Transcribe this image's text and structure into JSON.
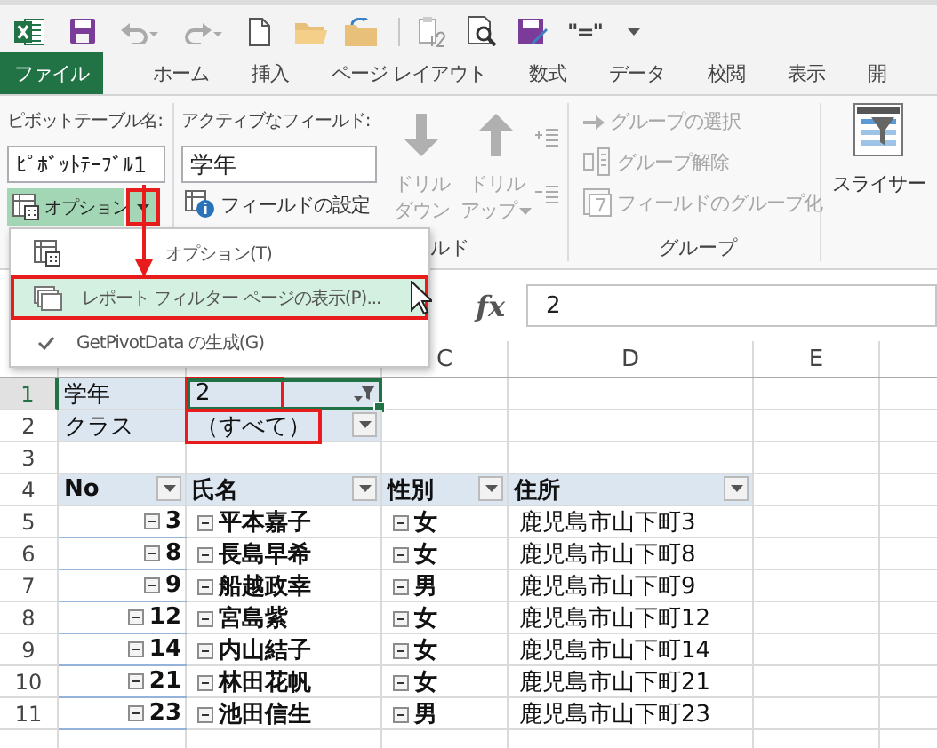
{
  "quick_access": {
    "equals_label": "\"=\""
  },
  "tabs": [
    {
      "label": "ファイル",
      "kind": "file",
      "selected": false
    },
    {
      "label": "ホーム",
      "kind": "tab",
      "selected": false
    },
    {
      "label": "挿入",
      "kind": "tab",
      "selected": false
    },
    {
      "label": "ページ レイアウト",
      "kind": "tab",
      "selected": false
    },
    {
      "label": "数式",
      "kind": "tab",
      "selected": false
    },
    {
      "label": "データ",
      "kind": "tab",
      "selected": false
    },
    {
      "label": "校閲",
      "kind": "tab",
      "selected": false
    },
    {
      "label": "表示",
      "kind": "tab",
      "selected": false
    },
    {
      "label": "開",
      "kind": "tab",
      "selected": false
    }
  ],
  "ribbon": {
    "pivot_name": {
      "label": "ピボットテーブル名:",
      "value": "ﾋﾟﾎﾞｯﾄﾃｰﾌﾞﾙ1"
    },
    "options_button": {
      "label": "オプション",
      "pressed": true,
      "dropdown_annotated": true
    },
    "active_field": {
      "label": "アクティブなフィールド:",
      "value": "学年",
      "settings_label": "フィールドの設定",
      "drill_down": {
        "label_lines": [
          "ドリル",
          "ダウン"
        ],
        "disabled": true
      },
      "drill_up": {
        "label_lines": [
          "ドリル",
          "アップ"
        ],
        "disabled": true
      },
      "group_label": "ルド"
    },
    "group": {
      "items": [
        {
          "label": "グループの選択",
          "kind": "select",
          "disabled": true
        },
        {
          "label": "グループ解除",
          "kind": "ungroup",
          "disabled": true
        },
        {
          "label": "フィールドのグループ化",
          "kind": "group-field",
          "disabled": true
        }
      ],
      "group_label": "グループ"
    },
    "slicer": {
      "label": "スライサー"
    }
  },
  "menu": {
    "items": [
      {
        "label": "オプション(T)",
        "kind": "options",
        "selected": false,
        "annotated": false
      },
      {
        "label": "レポート フィルター ページの表示(P)...",
        "kind": "pages",
        "selected": true,
        "annotated": true
      },
      {
        "label": "GetPivotData の生成(G)",
        "kind": "toggle",
        "checked": true,
        "selected": false,
        "annotated": false
      }
    ]
  },
  "formula_bar": {
    "function_label": "fx",
    "value": "2"
  },
  "sheet": {
    "column_headers": [
      "C",
      "D",
      "E"
    ],
    "rows": [
      {
        "number": "1",
        "active": true,
        "cells": [
          {
            "text": "学年",
            "kind": "filter-label"
          },
          {
            "text": "2",
            "kind": "filter-value",
            "filtered": true,
            "active": true,
            "annotated": true
          }
        ]
      },
      {
        "number": "2",
        "active": false,
        "cells": [
          {
            "text": "クラス",
            "kind": "filter-label"
          },
          {
            "text": "（すべて）",
            "kind": "filter-value",
            "filtered": false,
            "active": false,
            "annotated": true
          }
        ]
      },
      {
        "number": "3",
        "active": false,
        "cells": []
      },
      {
        "number": "4",
        "active": false,
        "cells": [
          {
            "text": "No",
            "kind": "header"
          },
          {
            "text": "氏名",
            "kind": "header"
          },
          {
            "text": "性別",
            "kind": "header"
          },
          {
            "text": "住所",
            "kind": "header"
          }
        ]
      },
      {
        "number": "5",
        "active": false,
        "cells": [
          {
            "text": "3",
            "kind": "item"
          },
          {
            "text": "平本嘉子",
            "kind": "item"
          },
          {
            "text": "女",
            "kind": "item"
          },
          {
            "text": "鹿児島市山下町3",
            "kind": "value"
          }
        ]
      },
      {
        "number": "6",
        "active": false,
        "cells": [
          {
            "text": "8",
            "kind": "item"
          },
          {
            "text": "長島早希",
            "kind": "item"
          },
          {
            "text": "女",
            "kind": "item"
          },
          {
            "text": "鹿児島市山下町8",
            "kind": "value"
          }
        ]
      },
      {
        "number": "7",
        "active": false,
        "cells": [
          {
            "text": "9",
            "kind": "item"
          },
          {
            "text": "船越政幸",
            "kind": "item"
          },
          {
            "text": "男",
            "kind": "item"
          },
          {
            "text": "鹿児島市山下町9",
            "kind": "value"
          }
        ]
      },
      {
        "number": "8",
        "active": false,
        "cells": [
          {
            "text": "12",
            "kind": "item"
          },
          {
            "text": "宮島紫",
            "kind": "item"
          },
          {
            "text": "女",
            "kind": "item"
          },
          {
            "text": "鹿児島市山下町12",
            "kind": "value"
          }
        ]
      },
      {
        "number": "9",
        "active": false,
        "cells": [
          {
            "text": "14",
            "kind": "item"
          },
          {
            "text": "内山結子",
            "kind": "item"
          },
          {
            "text": "女",
            "kind": "item"
          },
          {
            "text": "鹿児島市山下町14",
            "kind": "value"
          }
        ]
      },
      {
        "number": "10",
        "active": false,
        "cells": [
          {
            "text": "21",
            "kind": "item"
          },
          {
            "text": "林田花帆",
            "kind": "item"
          },
          {
            "text": "女",
            "kind": "item"
          },
          {
            "text": "鹿児島市山下町21",
            "kind": "value"
          }
        ]
      },
      {
        "number": "11",
        "active": false,
        "cells": [
          {
            "text": "23",
            "kind": "item"
          },
          {
            "text": "池田信生",
            "kind": "item"
          },
          {
            "text": "男",
            "kind": "item"
          },
          {
            "text": "鹿児島市山下町23",
            "kind": "value"
          }
        ]
      }
    ]
  }
}
